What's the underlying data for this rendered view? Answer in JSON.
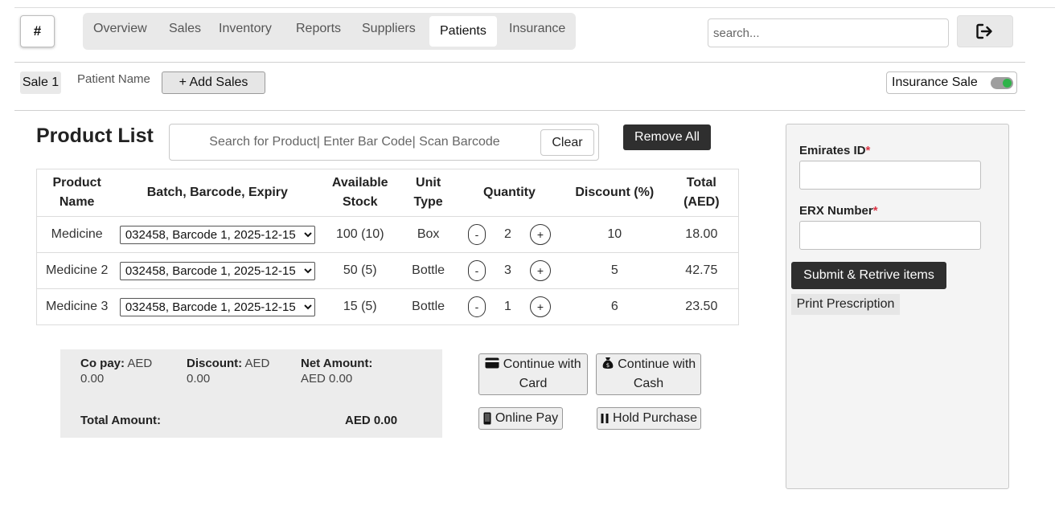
{
  "header": {
    "home_label": "#",
    "tabs": [
      {
        "label": "Overview"
      },
      {
        "label": "Sales"
      },
      {
        "label": "Inventory"
      },
      {
        "label": "Reports"
      },
      {
        "label": "Suppliers"
      },
      {
        "label": "Patients",
        "active": true
      },
      {
        "label": "Insurance"
      }
    ],
    "search_placeholder": "search...",
    "logout_icon": "sign-out-icon"
  },
  "sale_bar": {
    "sale_tab": "Sale 1",
    "patient_name_label": "Patient Name",
    "add_sales_label": "+ Add Sales",
    "insurance_sale_label": "Insurance Sale",
    "insurance_sale_on": true
  },
  "product_list": {
    "title": "Product List",
    "search_placeholder": "Search for Product| Enter Bar Code| Scan Barcode",
    "clear_label": "Clear",
    "remove_all_label": "Remove All",
    "columns": [
      "Product Name",
      "Batch, Barcode, Expiry",
      "Available Stock",
      "Unit Type",
      "Quantity",
      "Discount (%)",
      "Total (AED)"
    ],
    "rows": [
      {
        "name": "Medicine",
        "batch": "032458, Barcode 1, 2025-12-15",
        "stock": "100 (10)",
        "unit": "Box",
        "qty": "2",
        "discount": "10",
        "total": "18.00"
      },
      {
        "name": "Medicine 2",
        "batch": "032458, Barcode 1, 2025-12-15",
        "stock": "50 (5)",
        "unit": "Bottle",
        "qty": "3",
        "discount": "5",
        "total": "42.75"
      },
      {
        "name": "Medicine 3",
        "batch": "032458, Barcode 1, 2025-12-15",
        "stock": "15 (5)",
        "unit": "Bottle",
        "qty": "1",
        "discount": "6",
        "total": "23.50"
      }
    ],
    "minus_label": "-",
    "plus_label": "+"
  },
  "summary": {
    "copay_label": "Co pay:",
    "copay_value": "AED 0.00",
    "discount_label": "Discount:",
    "discount_value": "AED 0.00",
    "net_label": "Net Amount:",
    "net_value": "AED 0.00",
    "total_label": "Total Amount:",
    "total_value": "AED 0.00"
  },
  "payment": {
    "card_label": "Continue with Card",
    "cash_label": "Continue with Cash",
    "online_label": "Online Pay",
    "hold_label": "Hold Purchase",
    "card_icon": "credit-card-icon",
    "cash_icon": "money-bag-icon",
    "online_icon": "mobile-phone-icon",
    "hold_icon": "pause-icon"
  },
  "side_panel": {
    "emirates_id_label": "Emirates ID",
    "emirates_id_value": "",
    "erx_label": "ERX Number",
    "erx_value": "",
    "required_mark": "*",
    "submit_label": "Submit & Retrive items",
    "print_label": "Print Prescription"
  },
  "colors": {
    "dark_button": "#2f2f2f",
    "toggle_on": "#2fb34a",
    "required": "#dc3545",
    "panel_bg": "#f4f4f4"
  }
}
